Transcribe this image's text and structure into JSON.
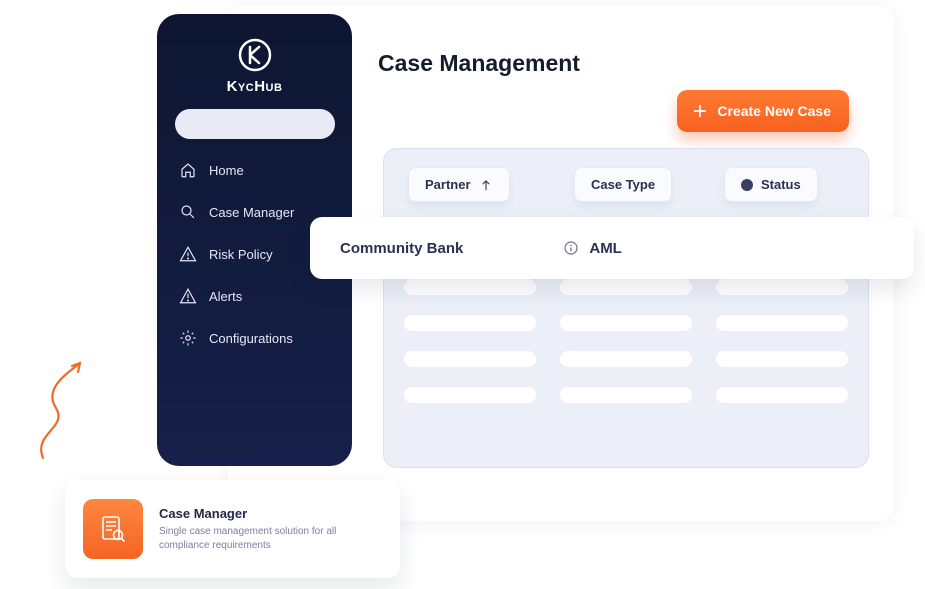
{
  "brand": {
    "name": "KycHub"
  },
  "sidebar": {
    "items": [
      {
        "label": "Home"
      },
      {
        "label": "Case Manager"
      },
      {
        "label": "Risk Policy"
      },
      {
        "label": "Alerts"
      },
      {
        "label": "Configurations"
      }
    ]
  },
  "page": {
    "title": "Case Management",
    "create_label": "Create New Case"
  },
  "columns": {
    "partner": "Partner",
    "case_type": "Case Type",
    "status": "Status"
  },
  "highlighted_row": {
    "partner": "Community Bank",
    "case_type": "AML"
  },
  "popover": {
    "title": "Case Manager",
    "description": "Single case management solution for all compliance requirements"
  },
  "colors": {
    "accent_orange": "#f7621f",
    "sidebar_bg": "#0d1631",
    "panel_bg": "#eceff8"
  }
}
